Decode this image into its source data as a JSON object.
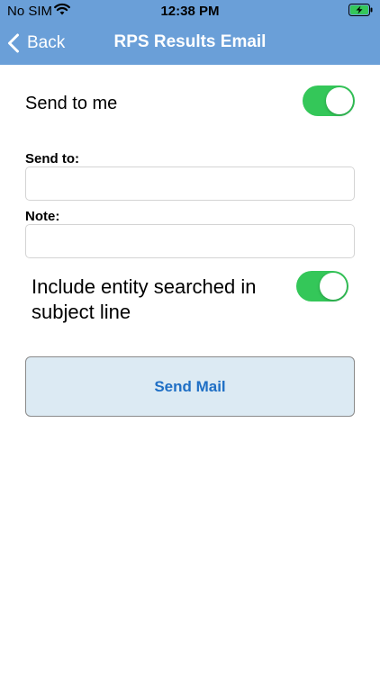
{
  "status_bar": {
    "carrier": "No SIM",
    "time": "12:38 PM",
    "icons": [
      "wifi-icon",
      "battery-charging-icon"
    ]
  },
  "nav": {
    "back_label": "Back",
    "title": "RPS Results Email",
    "back_icon": "chevron-left-icon"
  },
  "form": {
    "send_to_me": {
      "label": "Send to me",
      "on": true
    },
    "send_to": {
      "label": "Send to:",
      "value": "",
      "placeholder": ""
    },
    "note": {
      "label": "Note:",
      "value": "",
      "placeholder": ""
    },
    "include_entity": {
      "label": "Include entity searched in subject line",
      "on": true
    },
    "send_button_label": "Send Mail"
  },
  "colors": {
    "nav_background": "#6a9fd8",
    "toggle_on": "#34c759",
    "button_background": "#dceaf3",
    "button_text": "#1f6fc5"
  }
}
